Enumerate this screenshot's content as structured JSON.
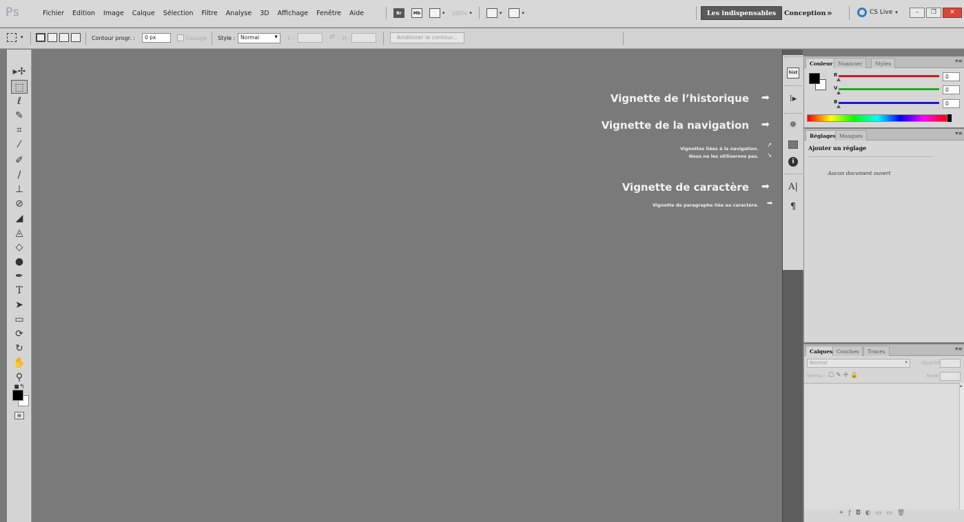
{
  "app": {
    "logo": "Ps",
    "menu": [
      "Fichier",
      "Edition",
      "Image",
      "Calque",
      "Sélection",
      "Filtre",
      "Analyse",
      "3D",
      "Affichage",
      "Fenêtre",
      "Aide"
    ],
    "zoom": "100%",
    "workspace_active": "Les indispensables",
    "workspace_other": "Conception",
    "workspace_more": "»",
    "cslive": "CS Live"
  },
  "options": {
    "feather_label": "Contour progr. :",
    "feather_value": "0 px",
    "antialias_label": "Lissage",
    "style_label": "Style :",
    "style_value": "Normal",
    "width_label": "L :",
    "height_label": "H :",
    "refine_label": "Améliorer le contour..."
  },
  "annotations": {
    "history": "Vignette de l’historique",
    "navigation": "Vignette de la navigation",
    "nav_related_1": "Vignettes liées à la navigation.",
    "nav_related_2": "Nous ne les utiliserons pas.",
    "character": "Vignette de caractère",
    "paragraph": "Vignette de paragraphe liée au caractère."
  },
  "color_panel": {
    "tabs": [
      "Couleur",
      "Nuancier",
      "Styles"
    ],
    "sliders": [
      {
        "label": "R",
        "value": "0",
        "color": "#d01818"
      },
      {
        "label": "V",
        "value": "0",
        "color": "#18b018"
      },
      {
        "label": "B",
        "value": "0",
        "color": "#1818c8"
      }
    ]
  },
  "adjustments_panel": {
    "tabs": [
      "Réglages",
      "Masques"
    ],
    "title": "Ajouter un réglage",
    "empty": "Aucun document ouvert"
  },
  "layers_panel": {
    "tabs": [
      "Calques",
      "Couches",
      "Tracés"
    ],
    "blend_mode": "Normal",
    "opacity_label": "Opacité :",
    "lock_label": "Verrou :",
    "fill_label": "Fond :"
  },
  "colors": {
    "canvas": "#7a7a7a",
    "chrome": "#d6d6d6",
    "active_workspace": "#5a5a5a",
    "cslive": "#2f7bc5"
  }
}
